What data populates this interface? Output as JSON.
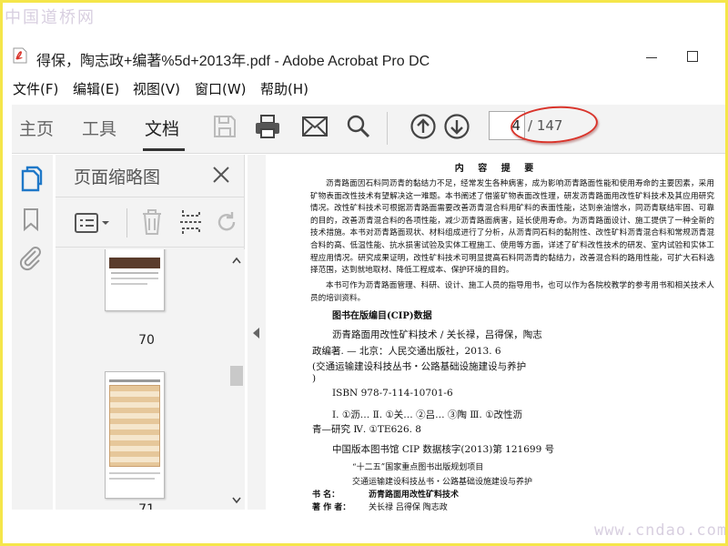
{
  "watermark_top": "中国道桥网",
  "watermark_bottom": "www.cndao.com",
  "window": {
    "title": "得保，陶志政+编著%5d+2013年.pdf - Adobe Acrobat Pro DC"
  },
  "menu": [
    "文件(F)",
    "编辑(E)",
    "视图(V)",
    "窗口(W)",
    "帮助(H)"
  ],
  "tabs": [
    {
      "label": "主页",
      "active": false
    },
    {
      "label": "工具",
      "active": false
    },
    {
      "label": "文档",
      "active": true
    }
  ],
  "toolbar": {
    "page_current": "4",
    "page_total": "/ 147",
    "highlight_color": "#d9342b"
  },
  "thumbnail_panel": {
    "title": "页面缩略图",
    "thumbnails": [
      {
        "label": "70"
      },
      {
        "label": "71"
      }
    ]
  },
  "document": {
    "heading": "内 容 提 要",
    "summary": "沥青路面因石料同沥青的黏结力不足，经常发生各种病害，成为影响沥青路面性能和使用寿命的主要因素，采用矿物表面改性技术有望解决这一难题。本书阐述了借鉴矿物表面改性理，研发沥青路面用改性矿料技术及其应用研究情况。改性矿料技术可根据沥青路面需要改善沥青混合料用矿料的表面性能，达到亲油憎水，同沥青联结牢固、可靠的目的，改善沥青混合料的各项性能，减少沥青路面病害，延长使用寿命。为沥青路面设计、施工提供了一种全新的技术措施。本书对沥青路面现状、材料组成进行了分析，从沥青同石料的黏附性、改性矿料沥青混合料和常规沥青混合料的高、低温性能、抗水损害试验及实体工程施工、使用等方面，详述了矿料改性技术的研发、室内试验和实体工程应用情况。研究成果证明，改性矿料技术可明显提高石料同沥青的黏结力，改善混合料的路用性能，可扩大石料选择范围，达到就地取材、降低工程成本、保护环境的目的。",
    "readership": "本书可作为沥青路面管理、科研、设计、施工人员的指导用书，也可以作为各院校教学的参考用书和相关技术人员的培训资料。",
    "cip_heading": "图书在版编目(CIP)数据",
    "cip_line1": "沥青路面用改性矿料技术 / 关长禄，吕得保，陶志",
    "cip_line2": "政编著. — 北京：人民交通出版社，2013. 6",
    "cip_line3": "(交通运输建设科技丛书・公路基础设施建设与养护",
    "cip_line4": ")",
    "isbn": "ISBN  978-7-114-10701-6",
    "class_line1": "Ⅰ. ①沥…   Ⅱ. ①关…  ②吕…  ③陶   Ⅲ. ①改性沥",
    "class_line2": "青—研究   Ⅳ. ①TE626. 8",
    "cip_core": "中国版本图书馆 CIP 数据核字(2013)第 121699 号",
    "series_line1": "“十二五”国家重点图书出版规划项目",
    "series_line2": "交通运输建设科技丛书・公路基础设施建设与养护",
    "book_label": "书       名：",
    "book_value": "沥青路面用改性矿料技术",
    "author_label": "著  作  者：",
    "author_value": "关长禄    吕得保    陶志政"
  }
}
